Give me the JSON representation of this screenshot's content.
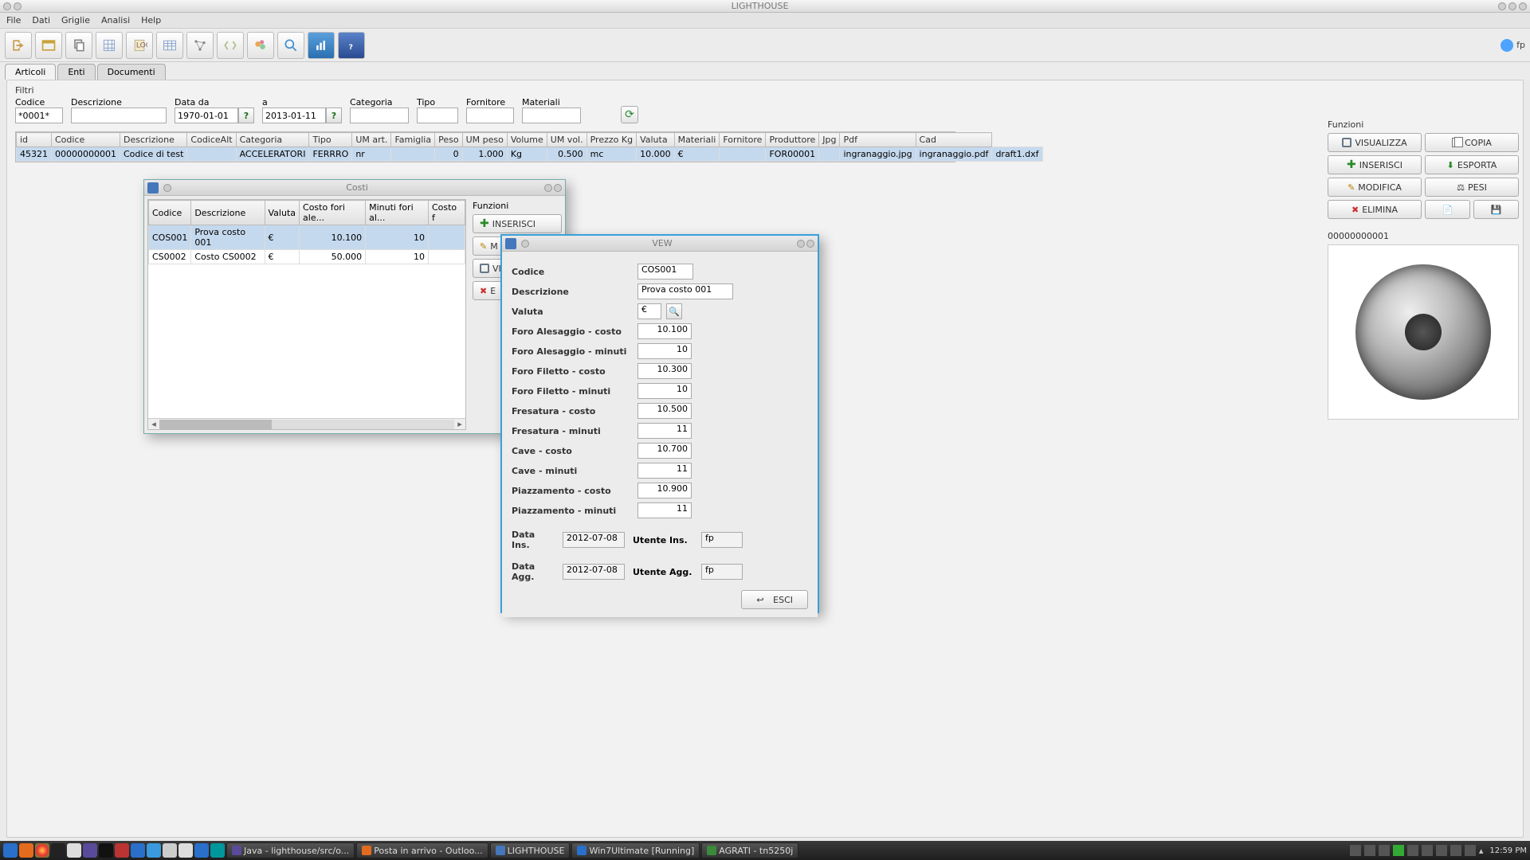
{
  "window": {
    "title": "LIGHTHOUSE"
  },
  "menu": [
    "File",
    "Dati",
    "Griglie",
    "Analisi",
    "Help"
  ],
  "user": "fp",
  "tabs": [
    "Articoli",
    "Enti",
    "Documenti"
  ],
  "filtri": {
    "title": "Filtri",
    "labels": {
      "codice": "Codice",
      "descrizione": "Descrizione",
      "datada": "Data da",
      "a": "a",
      "categoria": "Categoria",
      "tipo": "Tipo",
      "fornitore": "Fornitore",
      "materiali": "Materiali"
    },
    "values": {
      "codice": "*0001*",
      "datada": "1970-01-01",
      "a": "2013-01-11"
    }
  },
  "gridHeaders": [
    "id",
    "Codice",
    "Descrizione",
    "CodiceAlt",
    "Categoria",
    "Tipo",
    "UM art.",
    "Famiglia",
    "Peso",
    "UM peso",
    "Volume",
    "UM vol.",
    "Prezzo Kg",
    "Valuta",
    "Materiali",
    "Fornitore",
    "Produttore",
    "Jpg",
    "Pdf",
    "Cad"
  ],
  "gridRow": [
    "45321",
    "00000000001",
    "Codice di test",
    "",
    "ACCELERATORI",
    "FERRRO",
    "nr",
    "",
    "0",
    "1.000",
    "Kg",
    "0.500",
    "mc",
    "10.000",
    "€",
    "",
    "FOR00001",
    "",
    "ingranaggio.jpg",
    "ingranaggio.pdf",
    "draft1.dxf"
  ],
  "funzioni": {
    "title": "Funzioni",
    "visualizza": "VISUALIZZA",
    "copia": "COPIA",
    "inserisci": "INSERISCI",
    "esporta": "ESPORTA",
    "modifica": "MODIFICA",
    "pesi": "PESI",
    "elimina": "ELIMINA"
  },
  "previewCode": "00000000001",
  "costi": {
    "title": "Costi",
    "headers": [
      "Codice",
      "Descrizione",
      "Valuta",
      "Costo fori ale...",
      "Minuti fori al...",
      "Costo f"
    ],
    "rows": [
      [
        "COS001",
        "Prova costo 001",
        "€",
        "10.100",
        "10",
        ""
      ],
      [
        "CS0002",
        "Costo CS0002",
        "€",
        "50.000",
        "10",
        ""
      ]
    ],
    "side": {
      "title": "Funzioni",
      "inserisci": "INSERISCI",
      "m": "M",
      "vis": "VIS",
      "e": "E"
    }
  },
  "vew": {
    "title": "VEW",
    "labels": {
      "codice": "Codice",
      "descrizione": "Descrizione",
      "valuta": "Valuta",
      "foroAlesCosto": "Foro Alesaggio - costo",
      "foroAlesMin": "Foro Alesaggio - minuti",
      "foroFilCosto": "Foro Filetto - costo",
      "foroFilMin": "Foro Filetto - minuti",
      "fresCosto": "Fresatura - costo",
      "fresMin": "Fresatura - minuti",
      "caveCosto": "Cave - costo",
      "caveMin": "Cave - minuti",
      "piazCosto": "Piazzamento - costo",
      "piazMin": "Piazzamento - minuti",
      "dataIns": "Data Ins.",
      "utenteIns": "Utente Ins.",
      "dataAgg": "Data Agg.",
      "utenteAgg": "Utente Agg.",
      "esci": "ESCI"
    },
    "values": {
      "codice": "COS001",
      "descrizione": "Prova costo 001",
      "valuta": "€",
      "foroAlesCosto": "10.100",
      "foroAlesMin": "10",
      "foroFilCosto": "10.300",
      "foroFilMin": "10",
      "fresCosto": "10.500",
      "fresMin": "11",
      "caveCosto": "10.700",
      "caveMin": "11",
      "piazCosto": "10.900",
      "piazMin": "11",
      "dataIns": "2012-07-08",
      "utenteIns": "fp",
      "dataAgg": "2012-07-08",
      "utenteAgg": "fp"
    }
  },
  "taskbar": {
    "items": [
      "Java - lighthouse/src/o...",
      "Posta in arrivo - Outloo...",
      "LIGHTHOUSE",
      "Win7Ultimate [Running]",
      "AGRATI - tn5250j"
    ],
    "clock": "12:59 PM"
  }
}
